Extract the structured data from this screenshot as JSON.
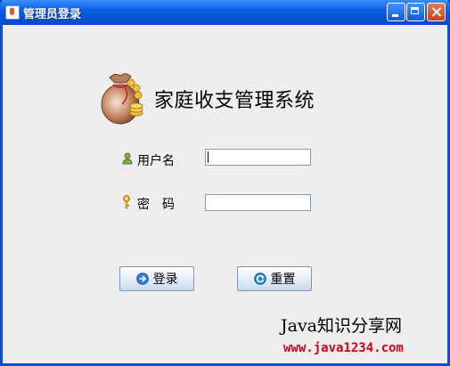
{
  "window": {
    "title": "管理员登录"
  },
  "header": {
    "system_title": "家庭收支管理系统"
  },
  "form": {
    "username_label": "用户名",
    "password_label": "密　码",
    "username_value": "",
    "password_value": ""
  },
  "buttons": {
    "login_label": "登录",
    "reset_label": "重置"
  },
  "watermark": {
    "line1": "Java知识分享网",
    "line2": "www.java1234.com"
  },
  "colors": {
    "titlebar": "#0a5fe6",
    "window_bg": "#eeeeee",
    "watermark_url": "#d0021b"
  }
}
